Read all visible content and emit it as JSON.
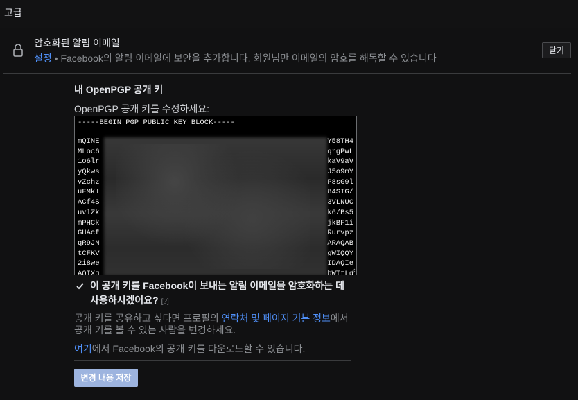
{
  "header": {
    "title": "고급"
  },
  "setting": {
    "title": "암호화된 알림 이메일",
    "link": "설정",
    "description": " • Facebook의 알림 이메일에 보안을 추가합니다. 회원님만 이메일의 암호를 해독할 수 있습니다",
    "close_label": "닫기"
  },
  "pgp": {
    "section_title": "내 OpenPGP 공개 키",
    "field_label": "OpenPGP 공개 키를 수정하세요:",
    "key_header": "-----BEGIN PGP PUBLIC KEY BLOCK-----",
    "key_lines": [
      {
        "left": "mQINE",
        "right": "Y58TH4"
      },
      {
        "left": "MLoc6",
        "right": "qrgPwL"
      },
      {
        "left": "1o6lr",
        "right": "kaV9aV"
      },
      {
        "left": "yQkws",
        "right": "J5o9mY"
      },
      {
        "left": "vZchz",
        "right": "P8sG9l"
      },
      {
        "left": "uFMk+",
        "right": "84SIG/"
      },
      {
        "left": "ACf4S",
        "right": "3VLNUC"
      },
      {
        "left": "uvlZk",
        "right": "k6/Bs5"
      },
      {
        "left": "mPHCk",
        "right": "jkBF1i"
      },
      {
        "left": "GHAcf",
        "right": "Rurvpz"
      },
      {
        "left": "qR9JN",
        "right": "ARAQAB"
      },
      {
        "left": "tCFKV",
        "right": "gWIQQY"
      },
      {
        "left": "2i8we",
        "right": "IDAQIe"
      },
      {
        "left": "AQIXg",
        "right": "bWTtLq"
      }
    ],
    "checkbox_label": "이 공개 키를 Facebook이 보내는 알림 이메일을 암호화하는 데 사용하시겠어요?",
    "checkbox_help": "[?]",
    "checkbox_checked": true,
    "share_text_before": "공개 키를 공유하고 싶다면 프로필의 ",
    "share_link": "연락처 및 페이지 기본 정보",
    "share_text_after": "에서 공개 키를 볼 수 있는 사람을 변경하세요.",
    "download_link": "여기",
    "download_text": "에서 Facebook의 공개 키를 다운로드할 수 있습니다.",
    "save_label": "변경 내용 저장"
  }
}
